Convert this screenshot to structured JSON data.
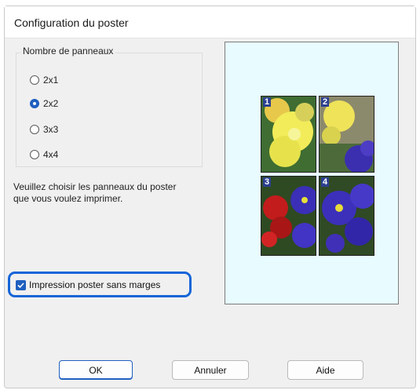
{
  "window": {
    "title": "Configuration du poster"
  },
  "panels_group": {
    "legend": "Nombre de panneaux",
    "options": [
      {
        "label": "2x1",
        "checked": false
      },
      {
        "label": "2x2",
        "checked": true
      },
      {
        "label": "3x3",
        "checked": false
      },
      {
        "label": "4x4",
        "checked": false
      }
    ]
  },
  "instructions": {
    "line1": "Veuillez choisir les panneaux du poster",
    "line2": "que vous voulez imprimer."
  },
  "borderless": {
    "label": "Impression poster sans marges",
    "checked": true
  },
  "preview": {
    "tiles": [
      "1",
      "2",
      "3",
      "4"
    ]
  },
  "buttons": {
    "ok": "OK",
    "cancel": "Annuler",
    "help": "Aide"
  },
  "colors": {
    "accent": "#1f5fbf",
    "highlight": "#1565d8",
    "preview_bg": "#e8fbff"
  }
}
